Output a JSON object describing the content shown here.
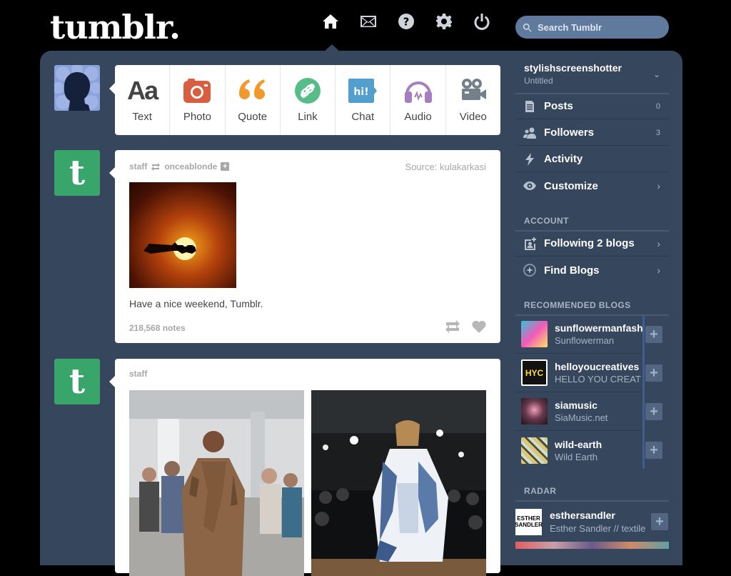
{
  "brand": {
    "logo_text": "tumblr."
  },
  "nav": {
    "items": [
      {
        "name": "home",
        "icon": "home-icon",
        "active": true
      },
      {
        "name": "inbox",
        "icon": "envelope-icon",
        "active": false
      },
      {
        "name": "help",
        "icon": "question-icon",
        "active": false
      },
      {
        "name": "settings",
        "icon": "gear-icon",
        "active": false
      },
      {
        "name": "logout",
        "icon": "power-icon",
        "active": false
      }
    ]
  },
  "search": {
    "placeholder": "Search Tumblr"
  },
  "composer": {
    "types": [
      {
        "label": "Text",
        "icon": "text-icon",
        "color": "#444444"
      },
      {
        "label": "Photo",
        "icon": "camera-icon",
        "color": "#d95e40"
      },
      {
        "label": "Quote",
        "icon": "quote-icon",
        "color": "#f2992e"
      },
      {
        "label": "Link",
        "icon": "link-icon",
        "color": "#56bc8a"
      },
      {
        "label": "Chat",
        "icon": "chat-icon",
        "color": "#529ecc"
      },
      {
        "label": "Audio",
        "icon": "headphones-icon",
        "color": "#a77dc2"
      },
      {
        "label": "Video",
        "icon": "video-camera-icon",
        "color": "#748089"
      }
    ]
  },
  "posts": [
    {
      "author": "staff",
      "reblogged_from": "onceablonde",
      "source_label": "Source:",
      "source": "kulakarkasi",
      "caption": "Have a nice weekend, Tumblr.",
      "notes": "218,568 notes"
    },
    {
      "author": "staff"
    }
  ],
  "sidebar": {
    "blog_name": "stylishscreenshotter",
    "blog_title": "Untitled",
    "menu": [
      {
        "label": "Posts",
        "icon": "document-icon",
        "count": "0"
      },
      {
        "label": "Followers",
        "icon": "followers-icon",
        "count": "3"
      },
      {
        "label": "Activity",
        "icon": "lightning-icon",
        "count": ""
      },
      {
        "label": "Customize",
        "icon": "eye-icon",
        "count": ""
      }
    ],
    "account_heading": "ACCOUNT",
    "account": [
      {
        "label": "Following 2 blogs",
        "icon": "add-person-icon"
      },
      {
        "label": "Find Blogs",
        "icon": "compass-icon"
      }
    ],
    "recommended_heading": "RECOMMENDED BLOGS",
    "recommended": [
      {
        "name": "sunflowermanfash",
        "subtitle": "Sunflowerman",
        "color": "#33b5c9"
      },
      {
        "name": "helloyoucreatives",
        "subtitle": "HELLO YOU CREAT",
        "color": "#1c1c1c"
      },
      {
        "name": "siamusic",
        "subtitle": "SiaMusic.net",
        "color": "#3a2a33"
      },
      {
        "name": "wild-earth",
        "subtitle": "Wild Earth",
        "color": "#b8ad6a"
      }
    ],
    "radar_heading": "RADAR",
    "radar": {
      "name": "esthersandler",
      "subtitle": "Esther Sandler // textile",
      "thumb_lines": [
        "ESTHER",
        "SANDLER"
      ]
    }
  }
}
